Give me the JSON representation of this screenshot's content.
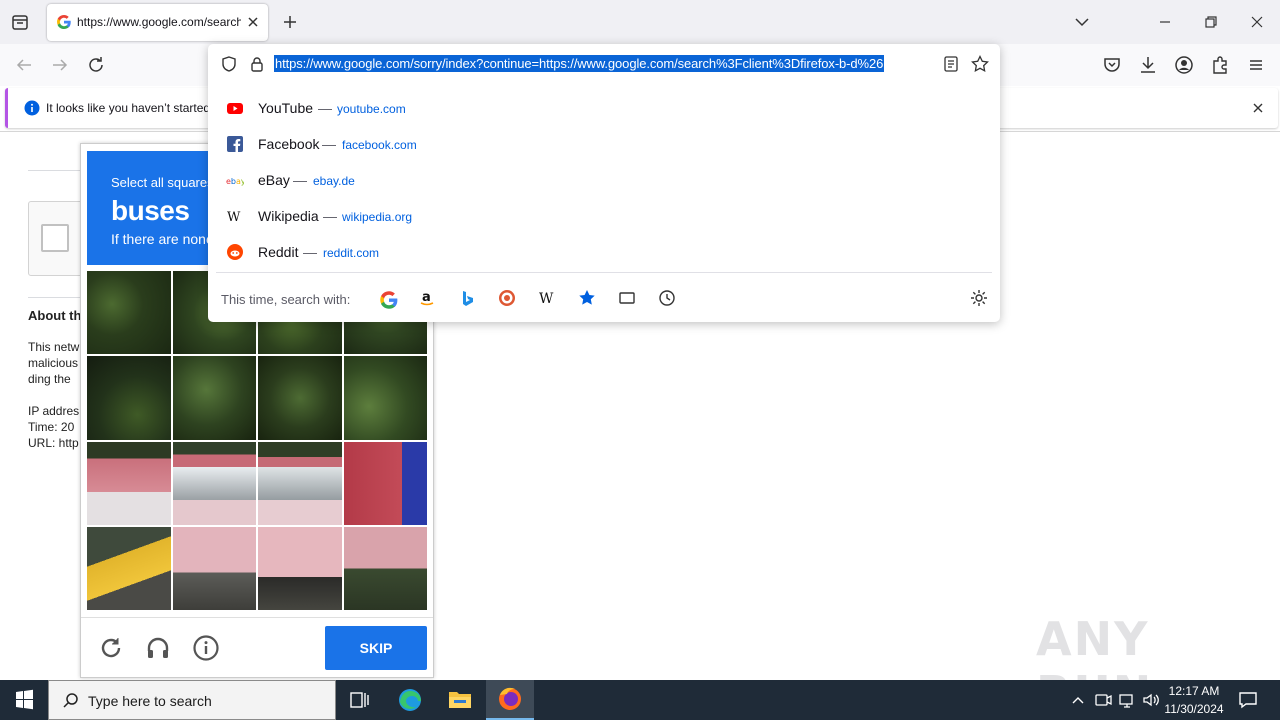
{
  "browser": {
    "tab": {
      "title": "https://www.google.com/search",
      "favicon": "google-g-icon"
    },
    "new_tab_icon": "plus-icon",
    "window_controls": [
      "list-all-tabs-icon",
      "minimize-icon",
      "restore-icon",
      "close-icon"
    ],
    "nav_icons": [
      "back-icon",
      "forward-icon",
      "reload-icon"
    ],
    "right_toolbar_icons": [
      "pocket-icon",
      "downloads-icon",
      "account-icon",
      "extensions-icon",
      "menu-icon"
    ]
  },
  "notification": {
    "text": "It looks like you haven’t started",
    "icon": "info-icon"
  },
  "urlbar": {
    "url": "https://www.google.com/sorry/index?continue=https://www.google.com/search%3Fclient%3Dfirefox-b-d%26",
    "suggestions": [
      {
        "title": "YouTube",
        "url": "youtube.com",
        "icon": "youtube-icon"
      },
      {
        "title": "Facebook",
        "url": "facebook.com",
        "icon": "facebook-icon"
      },
      {
        "title": "eBay",
        "url": "ebay.de",
        "icon": "ebay-icon"
      },
      {
        "title": "Wikipedia",
        "url": "wikipedia.org",
        "icon": "wikipedia-icon"
      },
      {
        "title": "Reddit",
        "url": "reddit.com",
        "icon": "reddit-icon"
      }
    ],
    "dash": "—",
    "search_with_label": "This time, search with:",
    "engines": [
      "google-icon",
      "amazon-icon",
      "bing-icon",
      "duckduckgo-icon",
      "wikipedia-icon",
      "bookmarks-icon",
      "tabs-icon",
      "history-icon"
    ]
  },
  "page": {
    "about_heading": "About th",
    "lines": [
      "This netw",
      "malicious",
      "ding the",
      "IP addres",
      "Time: 20",
      "URL: http"
    ]
  },
  "captcha": {
    "instruction_line1": "Select all squares",
    "target": "buses",
    "instruction_line3": "If there are none",
    "skip_label": "SKIP",
    "footer_icons": [
      "reload-icon",
      "audio-icon",
      "info-icon"
    ]
  },
  "watermark": "ANY RUN",
  "taskbar": {
    "search_placeholder": "Type here to search",
    "apps": [
      "task-view-icon",
      "edge-icon",
      "file-explorer-icon",
      "firefox-icon"
    ],
    "tray_icons": [
      "chevron-up-icon",
      "meet-now-icon",
      "network-icon",
      "volume-icon"
    ],
    "time": "12:17 AM",
    "date": "11/30/2024"
  }
}
